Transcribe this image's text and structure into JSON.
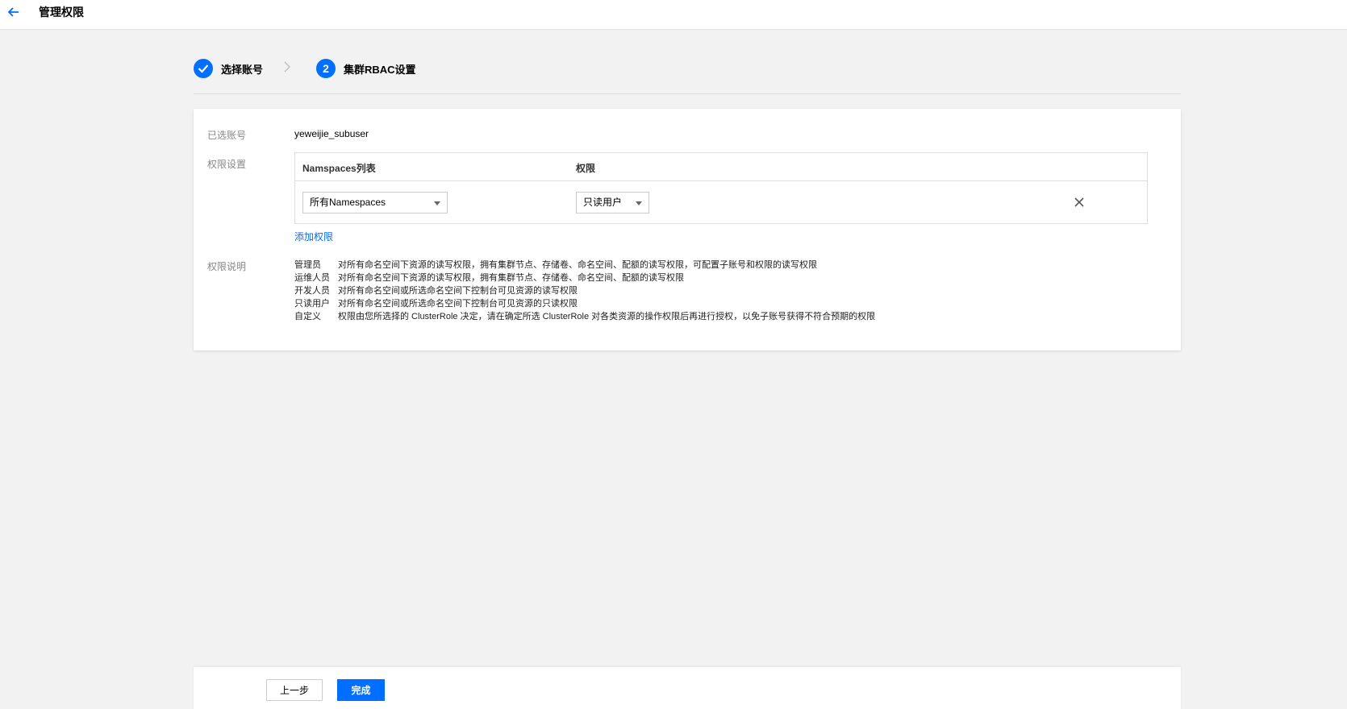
{
  "header": {
    "title": "管理权限",
    "back_icon": "arrow-left-icon"
  },
  "steps": [
    {
      "index": "1",
      "label": "选择账号",
      "status": "done"
    },
    {
      "index": "2",
      "label": "集群RBAC设置",
      "status": "active"
    }
  ],
  "form": {
    "account_label": "已选账号",
    "account_value": "yeweijie_subuser",
    "perm_label": "权限设置",
    "table": {
      "col_namespace": "Namspaces列表",
      "col_permission": "权限",
      "rows": [
        {
          "namespace": "所有Namespaces",
          "permission": "只读用户"
        }
      ]
    },
    "add_link": "添加权限",
    "desc_label": "权限说明",
    "descriptions": [
      {
        "role": "管理员",
        "text": "对所有命名空间下资源的读写权限，拥有集群节点、存储卷、命名空间、配额的读写权限，可配置子账号和权限的读写权限"
      },
      {
        "role": "运维人员",
        "text": "对所有命名空间下资源的读写权限，拥有集群节点、存储卷、命名空间、配额的读写权限"
      },
      {
        "role": "开发人员",
        "text": "对所有命名空间或所选命名空间下控制台可见资源的读写权限"
      },
      {
        "role": "只读用户",
        "text": "对所有命名空间或所选命名空间下控制台可见资源的只读权限"
      },
      {
        "role": "自定义",
        "text": "权限由您所选择的 ClusterRole 决定，请在确定所选 ClusterRole 对各类资源的操作权限后再进行授权，以免子账号获得不符合预期的权限"
      }
    ]
  },
  "footer": {
    "prev_label": "上一步",
    "done_label": "完成"
  },
  "colors": {
    "accent": "#006eff",
    "background": "#f2f2f2"
  }
}
